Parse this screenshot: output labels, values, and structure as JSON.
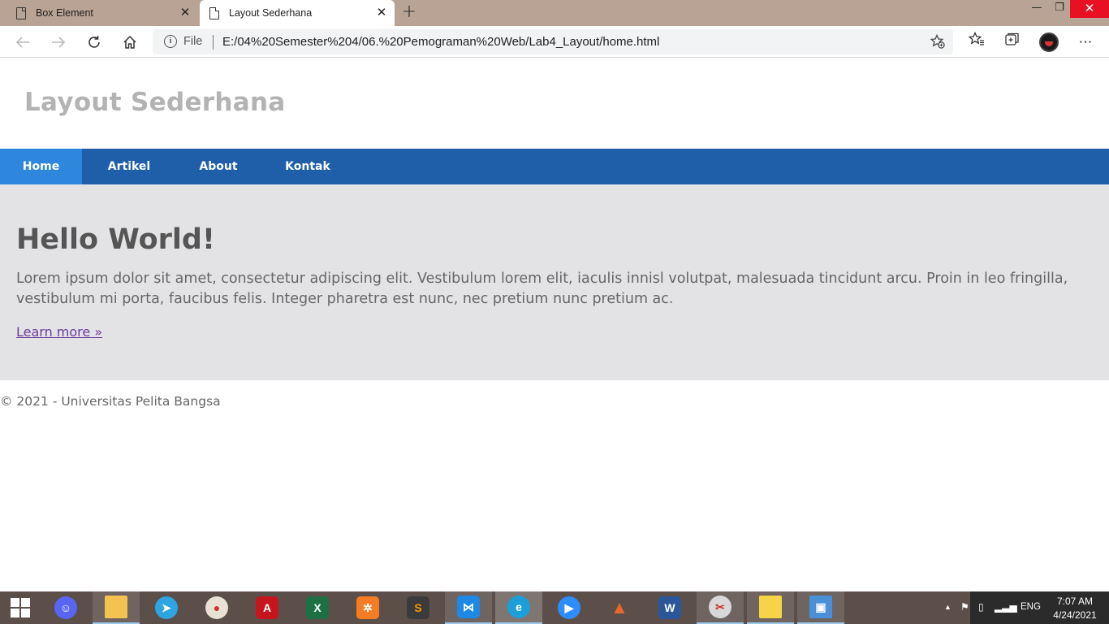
{
  "browser": {
    "tabs": [
      {
        "title": "Box Element",
        "active": false
      },
      {
        "title": "Layout Sederhana",
        "active": true
      }
    ],
    "address": {
      "scheme_label": "File",
      "url": "E:/04%20Semester%204/06.%20Pemograman%20Web/Lab4_Layout/home.html"
    },
    "icons": {
      "back": "back-arrow-icon",
      "forward": "forward-arrow-icon",
      "reload": "reload-icon",
      "home": "home-icon",
      "info": "info-icon",
      "add_favorite": "star-plus-icon",
      "favorites": "favorites-icon",
      "collections": "collections-icon",
      "profile": "profile-avatar",
      "menu": "more-icon"
    }
  },
  "site": {
    "title": "Layout Sederhana",
    "nav": [
      {
        "label": "Home",
        "active": true
      },
      {
        "label": "Artikel",
        "active": false
      },
      {
        "label": "About",
        "active": false
      },
      {
        "label": "Kontak",
        "active": false
      }
    ],
    "hero": {
      "heading": "Hello World!",
      "text": "Lorem ipsum dolor sit amet, consectetur adipiscing elit. Vestibulum lorem elit, iaculis innisl volutpat, malesuada tincidunt arcu. Proin in leo fringilla, vestibulum mi porta, faucibus felis. Integer pharetra est nunc, nec pretium nunc pretium ac.",
      "link": "Learn more »"
    },
    "footer": "© 2021 - Universitas Pelita Bangsa",
    "colors": {
      "navbar": "#1f5faa",
      "nav_active": "#2f86dd",
      "hero_bg": "#e3e3e6",
      "title": "#b3b3b3"
    }
  },
  "taskbar": {
    "apps": [
      "Discord",
      "File Explorer",
      "Telegram",
      "Paint",
      "Acrobat Reader",
      "Excel",
      "XAMPP",
      "Sublime Text",
      "Visual Studio Code",
      "Microsoft Edge",
      "Zoom",
      "MATLAB",
      "Word",
      "Snipping Tool",
      "Sticky Notes",
      "Photos"
    ],
    "language": "ENG",
    "time": "7:07 AM",
    "date": "4/24/2021"
  }
}
